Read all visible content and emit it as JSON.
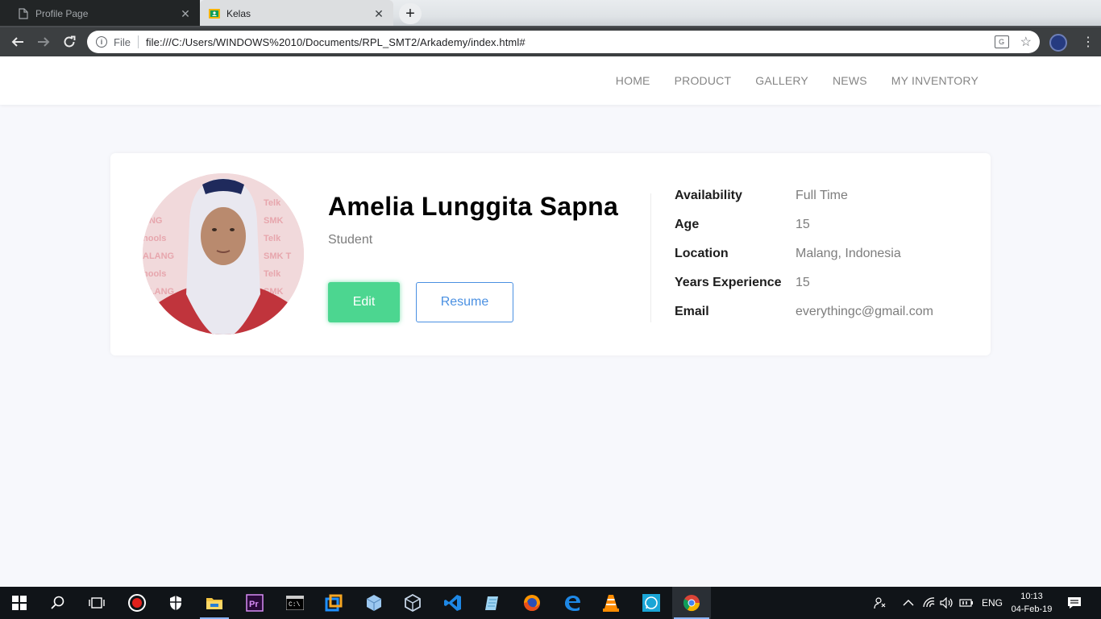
{
  "browser": {
    "tabs": [
      {
        "title": "Profile Page",
        "icon": "document-icon",
        "active": false
      },
      {
        "title": "Kelas",
        "icon": "classroom-icon",
        "active": true
      }
    ],
    "new_tab": "+",
    "url_scheme": "File",
    "url": "file:///C:/Users/WINDOWS%2010/Documents/RPL_SMT2/Arkademy/index.html#"
  },
  "navbar": {
    "items": [
      "HOME",
      "PRODUCT",
      "GALLERY",
      "NEWS",
      "MY INVENTORY"
    ]
  },
  "profile": {
    "name": "Amelia Lunggita Sapna",
    "role": "Student",
    "edit_label": "Edit",
    "resume_label": "Resume",
    "details": [
      {
        "label": "Availability",
        "value": "Full Time"
      },
      {
        "label": "Age",
        "value": "15"
      },
      {
        "label": "Location",
        "value": "Malang, Indonesia"
      },
      {
        "label": "Years Experience",
        "value": "15"
      },
      {
        "label": "Email",
        "value": "everythingc@gmail.com"
      }
    ]
  },
  "taskbar": {
    "apps": [
      "start-icon",
      "search-icon",
      "task-view-icon",
      "record-icon",
      "security-icon",
      "file-explorer-icon",
      "premiere-icon",
      "terminal-icon",
      "app-icon",
      "box-icon",
      "virtualbox-icon",
      "vscode-icon",
      "notepad-icon",
      "firefox-icon",
      "edge-icon",
      "vlc-icon",
      "whatsapp-icon",
      "chrome-icon"
    ],
    "language": "ENG",
    "time": "10:13",
    "date": "04-Feb-19"
  },
  "colors": {
    "accent_green": "#4cd690",
    "accent_blue": "#4a90e2",
    "page_bg": "#f7f8fc"
  }
}
